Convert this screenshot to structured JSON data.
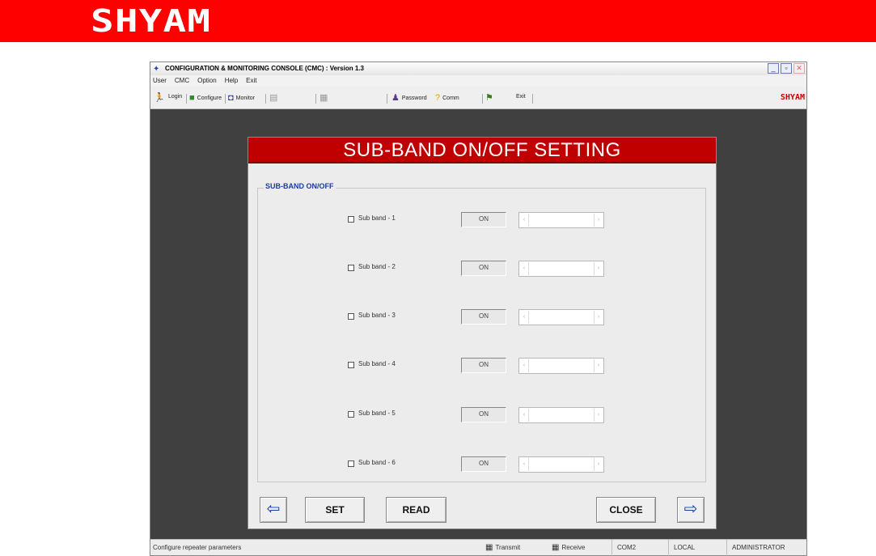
{
  "banner": {
    "logo": "SHYAM"
  },
  "window": {
    "title": "CONFIGURATION & MONITORING CONSOLE (CMC) : Version 1.3",
    "menu": [
      "User",
      "CMC",
      "Option",
      "Help",
      "Exit"
    ],
    "toolbar": {
      "login": "Login",
      "configure": "Configure",
      "monitor": "Monitor",
      "password": "Password",
      "comm": "Comm",
      "exit": "Exit",
      "brand": "SHYAM"
    }
  },
  "dialog": {
    "title": "SUB-BAND ON/OFF SETTING",
    "group_title": "SUB-BAND ON/OFF",
    "rows": [
      {
        "label": "Sub band - 1",
        "state": "ON"
      },
      {
        "label": "Sub band - 2",
        "state": "ON"
      },
      {
        "label": "Sub band - 3",
        "state": "ON"
      },
      {
        "label": "Sub band - 4",
        "state": "ON"
      },
      {
        "label": "Sub band - 5",
        "state": "ON"
      },
      {
        "label": "Sub band - 6",
        "state": "ON"
      }
    ],
    "buttons": {
      "set": "SET",
      "read": "READ",
      "close": "CLOSE"
    }
  },
  "statusbar": {
    "message": "Configure repeater parameters",
    "transmit": "Transmit",
    "receive": "Receive",
    "port": "COM2",
    "mode": "LOCAL",
    "user": "ADMINISTRATOR"
  },
  "colors": {
    "banner": "#ff0000",
    "dialog_header": "#c00000",
    "group_title": "#1a3aa8"
  }
}
